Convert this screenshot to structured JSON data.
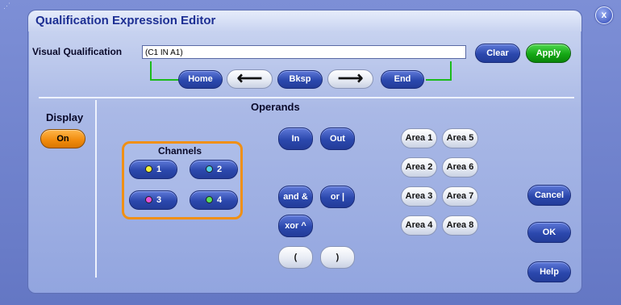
{
  "window": {
    "title": "Qualification Expression Editor",
    "close_label": "x"
  },
  "visual": {
    "label": "Visual Qualification",
    "expression": "(C1 IN A1)",
    "clear_label": "Clear",
    "apply_label": "Apply"
  },
  "nav": {
    "home": "Home",
    "bksp": "Bksp",
    "end": "End"
  },
  "display": {
    "label": "Display",
    "value": "On"
  },
  "operands": {
    "label": "Operands",
    "in": "In",
    "out": "Out",
    "and": "and &",
    "or": "or |",
    "xor": "xor ^",
    "open_paren": "(",
    "close_paren": ")"
  },
  "channels": {
    "label": "Channels",
    "items": [
      {
        "label": "1",
        "color": "#f2f23a"
      },
      {
        "label": "2",
        "color": "#4fd3e8"
      },
      {
        "label": "3",
        "color": "#e84fd8"
      },
      {
        "label": "4",
        "color": "#56e05a"
      }
    ]
  },
  "areas": [
    "Area 1",
    "Area 2",
    "Area 3",
    "Area 4",
    "Area 5",
    "Area 6",
    "Area 7",
    "Area 8"
  ],
  "actions": {
    "cancel": "Cancel",
    "ok": "OK",
    "help": "Help"
  }
}
